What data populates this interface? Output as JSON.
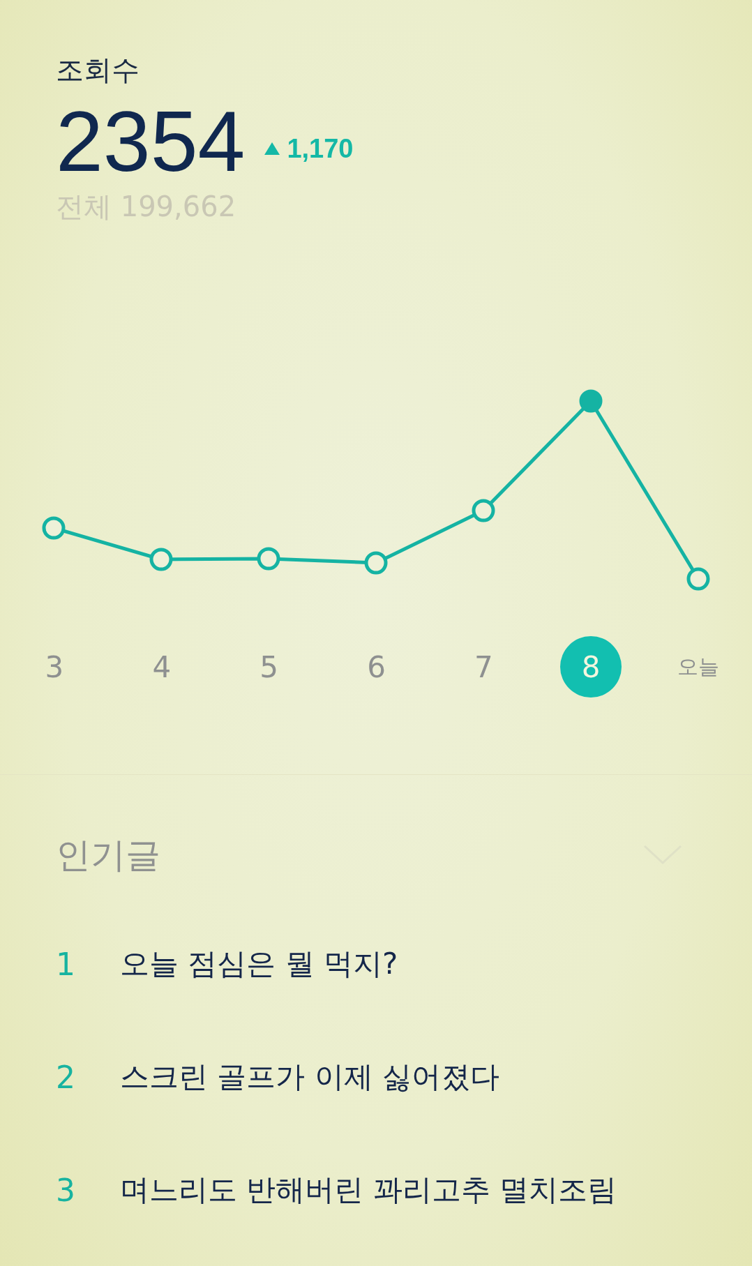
{
  "views": {
    "title": "조회수",
    "count": "2354",
    "change": "1,170",
    "total": "전체 199,662"
  },
  "days": [
    {
      "label": "3",
      "selected": false
    },
    {
      "label": "4",
      "selected": false
    },
    {
      "label": "5",
      "selected": false
    },
    {
      "label": "6",
      "selected": false
    },
    {
      "label": "7",
      "selected": false
    },
    {
      "label": "8",
      "selected": true
    },
    {
      "label": "오늘",
      "selected": false
    }
  ],
  "popular": {
    "title": "인기글",
    "items": [
      {
        "rank": "1",
        "title": "오늘 점심은 뭘 먹지?"
      },
      {
        "rank": "2",
        "title": "스크린 골프가 이제 싫어졌다"
      },
      {
        "rank": "3",
        "title": "며느리도 반해버린 꽈리고추 멸치조림"
      }
    ]
  }
}
